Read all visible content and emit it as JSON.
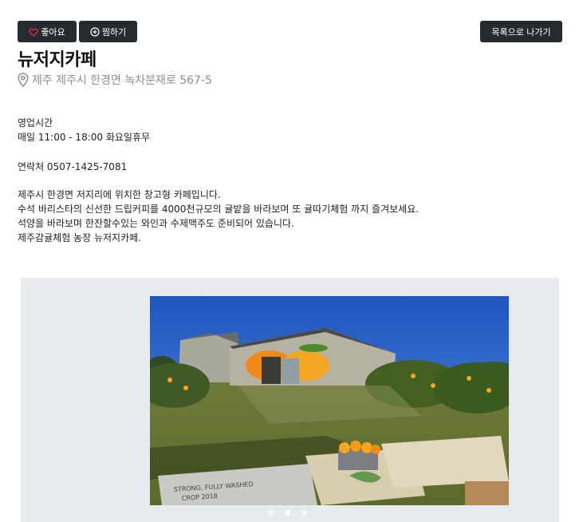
{
  "actions": {
    "like_label": "좋아요",
    "save_label": "찜하기",
    "back_label": "목록으로 나가기"
  },
  "place": {
    "name": "뉴저지카페",
    "address": "제주 제주시 한경면 녹차분재로 567-5"
  },
  "details": {
    "hours_title": "영업시간",
    "hours_value": "매일 11:00 - 18:00 화요일휴무",
    "contact": "연락처 0507-1425-7081",
    "description": [
      "제주시 한경면 저지리에 위치한 창고형 카페입니다.",
      "수석 바리스타의 신선한 드립커피를 4000천규모의 귤밭을 바라보며 또 귤따기체험 까지 즐겨보세요.",
      "석양을 바라보며 한잔할수있는 와인과 수제맥주도 준비되어 있습니다.",
      "제주감귤체험 농장 뉴저지카페."
    ]
  },
  "photo": {
    "sack_text_1": "STRONG, FULLY WASHED",
    "sack_text_2": "CROP 2018"
  },
  "colors": {
    "button_bg": "#262b30",
    "heart_red": "#e0323c",
    "address_gray": "#8a8f94",
    "carousel_bg": "#e8ebed",
    "sky_blue": "#2b63c6",
    "orange": "#f5a623"
  },
  "icons": {
    "like": "heart-icon",
    "save": "plus-circle-icon",
    "address": "map-pin-icon"
  },
  "carousel": {
    "slide_count": 3,
    "active_index": 1
  }
}
